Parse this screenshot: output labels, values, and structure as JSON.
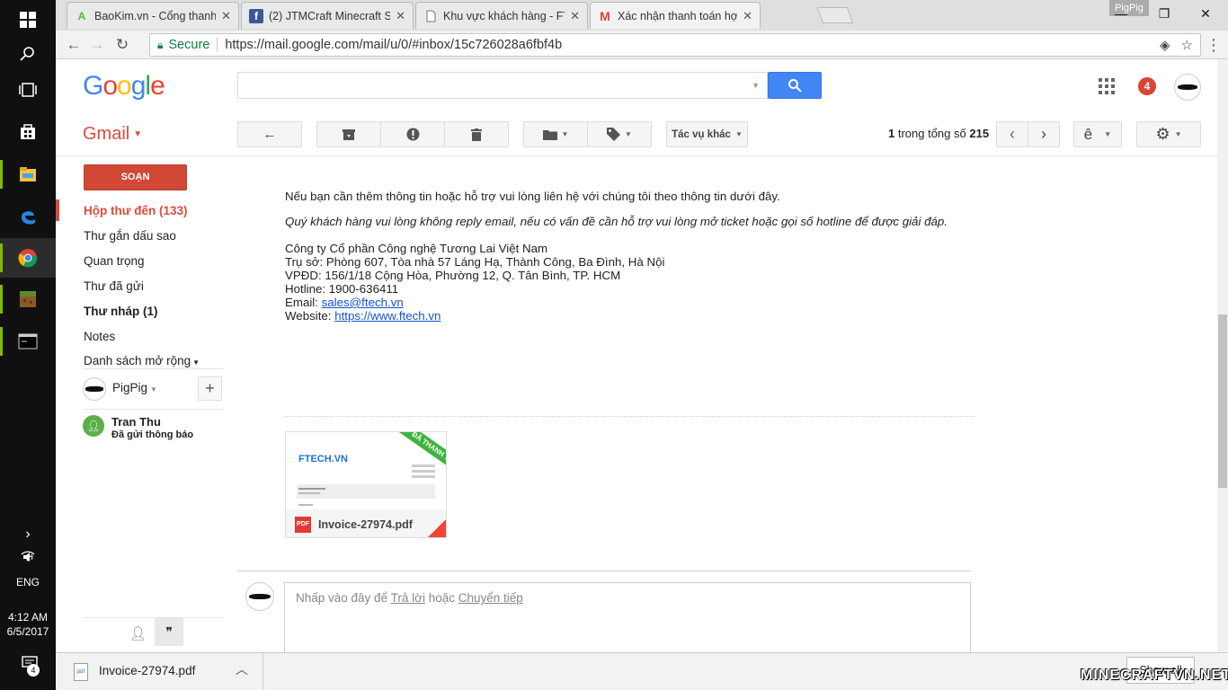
{
  "taskbar": {
    "language": "ENG",
    "time": "4:12 AM",
    "date": "6/5/2017",
    "notification_count": "4"
  },
  "browser": {
    "tabs": [
      {
        "label": "BaoKim.vn - Cổng thanh",
        "icon": "baokim-icon"
      },
      {
        "label": "(2) JTMCraft Minecraft Se",
        "icon": "facebook-icon"
      },
      {
        "label": "Khu vực khách hàng - FT",
        "icon": "page-icon"
      },
      {
        "label": "Xác nhận thanh toán hợp",
        "icon": "gmail-icon"
      }
    ],
    "profile_name": "PigPig",
    "secure_label": "Secure",
    "url": "https://mail.google.com/mail/u/0/#inbox/15c726028a6fbf4b"
  },
  "gmail": {
    "logo": "Google",
    "app_label": "Gmail",
    "notification_count": "4",
    "search_placeholder": "",
    "more_actions": "Tác vụ khác",
    "paging": {
      "start": "1",
      "middle": " trong tổng số ",
      "total": "215"
    },
    "input_tool": "ê"
  },
  "sidebar": {
    "compose": "SOẠN",
    "items": [
      {
        "label": "Hộp thư đến (133)"
      },
      {
        "label": "Thư gắn dấu sao"
      },
      {
        "label": "Quan trọng"
      },
      {
        "label": "Thư đã gửi"
      },
      {
        "label": "Thư nháp (1)"
      },
      {
        "label": "Notes"
      },
      {
        "label": "Danh sách mở rộng"
      }
    ],
    "hangouts_user": "PigPig",
    "contact_name": "Tran Thu",
    "contact_status": "Đã gửi thông báo"
  },
  "message": {
    "line1": "Nếu bạn cần thêm thông tin hoặc hỗ trợ vui lòng liên hệ với chúng tôi theo thông tin dưới đây.",
    "line2": "Quý khách hàng vui lòng không reply email, nếu có vấn đề cần hỗ trợ vui lòng mở ticket hoặc gọi số hotline để được giải đáp.",
    "company": "Công ty Cổ phần Công nghệ Tương Lai Việt Nam",
    "address": "Trụ sở: Phòng 607, Tòa nhà 57 Láng Hạ, Thành Công, Ba Đình, Hà Nội",
    "office": "VPĐD: 156/1/18 Cộng Hòa, Phường 12, Q. Tân Bình, TP. HCM",
    "hotline": "Hotline: 1900-636411",
    "email_label": "Email: ",
    "email": "sales@ftech.vn",
    "website_label": "Website: ",
    "website": "https://www.ftech.vn",
    "attachment": {
      "filename": "Invoice-27974.pdf",
      "brand": "FTECH.VN",
      "ribbon": "ĐÃ THANH TOÁN",
      "type": "PDF"
    },
    "reply": {
      "prefix": "Nhấp vào đây để ",
      "reply": "Trả lời",
      "middle": " hoặc ",
      "forward": "Chuyển tiếp"
    }
  },
  "downloads": {
    "filename": "Invoice-27974.pdf",
    "show_all": "Show all"
  },
  "watermark": "MINECRAFTVN.NET",
  "colors": {
    "gmail_red": "#dd4b39",
    "compose_red": "#d14836",
    "search_blue": "#4285f4",
    "link_blue": "#1155cc"
  }
}
